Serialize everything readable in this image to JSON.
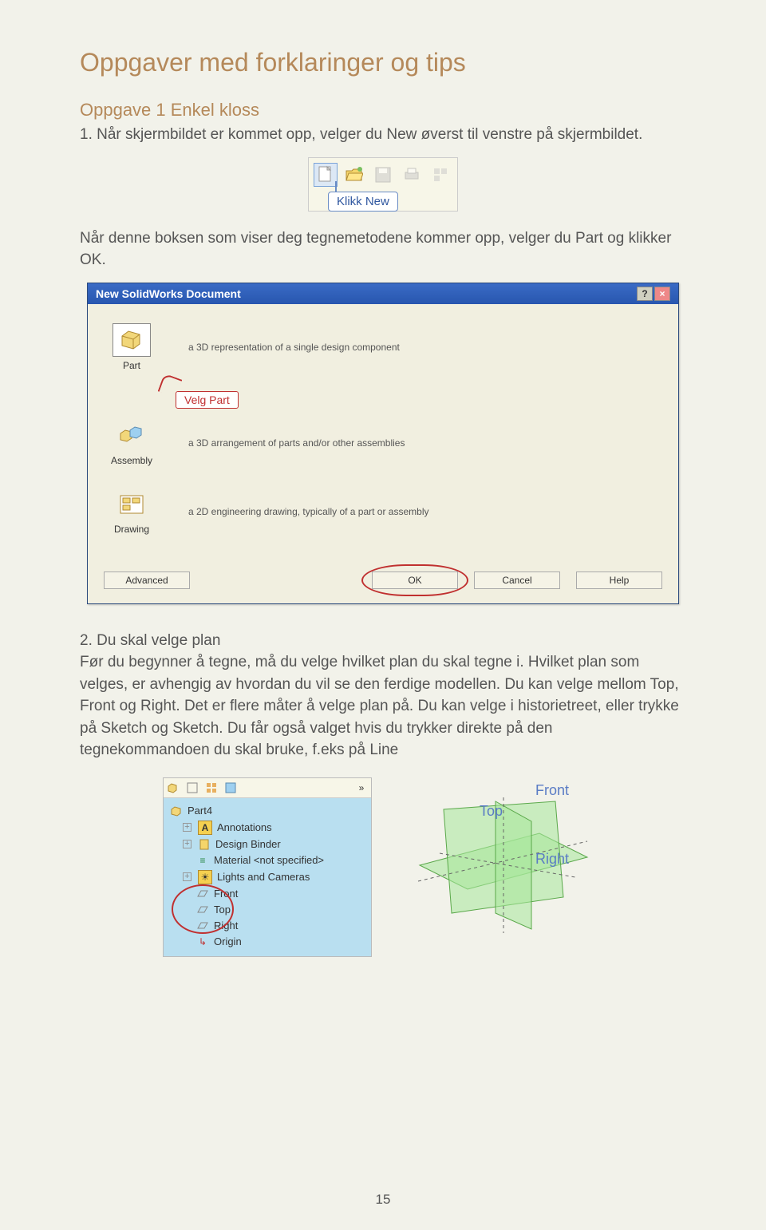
{
  "title": "Oppgaver med forklaringer og tips",
  "subtitle": "Oppgave 1 Enkel kloss",
  "para1": "1. Når skjermbildet er kommet opp, velger du New øverst til venstre på skjermbildet.",
  "klikk_new": "Klikk New",
  "para2": "Når denne boksen som viser deg tegnemetodene kommer opp, velger du Part og klikker OK.",
  "dialog": {
    "title": "New SolidWorks Document",
    "rows": [
      {
        "label": "Part",
        "desc": "a 3D representation of a single design component"
      },
      {
        "label": "Assembly",
        "desc": "a 3D arrangement of parts and/or other assemblies"
      },
      {
        "label": "Drawing",
        "desc": "a 2D engineering drawing, typically of a part or assembly"
      }
    ],
    "velg_part": "Velg Part",
    "buttons": {
      "advanced": "Advanced",
      "ok": "OK",
      "cancel": "Cancel",
      "help": "Help"
    }
  },
  "para3_lead": "2. Du skal velge plan",
  "para3": "Før du begynner å tegne, må du velge hvilket plan du skal tegne i. Hvilket plan som velges, er avhengig av hvordan du vil se den ferdige modellen. Du kan velge mellom Top, Front og Right. Det er flere måter å velge plan på. Du kan velge i historietreet, eller trykke på Sketch og Sketch. Du får også valget hvis du trykker direkte på den tegnekommandoen du skal bruke, f.eks på Line",
  "tree": {
    "root": "Part4",
    "items": [
      "Annotations",
      "Design Binder",
      "Material <not specified>",
      "Lights and Cameras",
      "Front",
      "Top",
      "Right",
      "Origin"
    ]
  },
  "planes": {
    "front": "Front",
    "top": "Top",
    "right": "Right"
  },
  "page_num": "15"
}
